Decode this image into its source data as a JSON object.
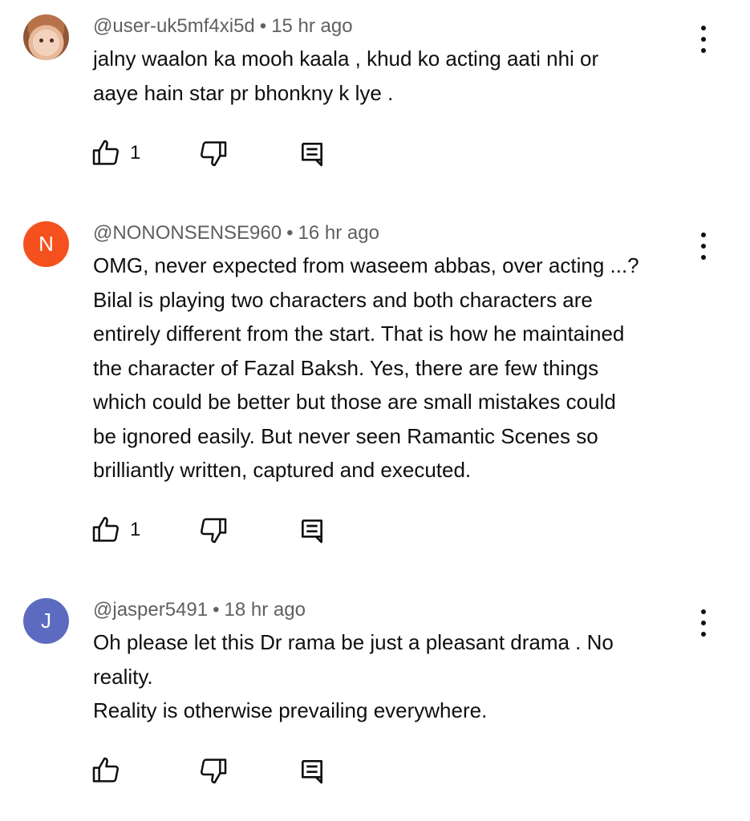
{
  "comments": [
    {
      "author": "@user-uk5mf4xi5d",
      "separator": "•",
      "time": "15 hr ago",
      "avatar_letter": "",
      "avatar_color": "#b7724a",
      "lines": [
        "jalny waalon ka mooh kaala , khud ko acting aati nhi or",
        "aaye hain star pr bhonkny k lye ."
      ],
      "like_count": "1",
      "icons": {
        "like": "thumbs-up-icon",
        "dislike": "thumbs-down-icon",
        "reply": "reply-comment-icon",
        "more": "more-vertical-icon"
      }
    },
    {
      "author": "@NONONSENSE960",
      "separator": "•",
      "time": "16 hr ago",
      "avatar_letter": "N",
      "avatar_color": "#f4511e",
      "lines": [
        "OMG, never expected from waseem abbas, over acting ...?",
        "Bilal is playing two characters and both characters are",
        "entirely different from the start. That is how he maintained",
        "the character of Fazal Baksh. Yes, there are few things",
        "which could be better but those are small mistakes could",
        "be ignored easily. But never seen Ramantic Scenes so",
        "brilliantly written, captured and executed."
      ],
      "like_count": "1",
      "icons": {
        "like": "thumbs-up-icon",
        "dislike": "thumbs-down-icon",
        "reply": "reply-comment-icon",
        "more": "more-vertical-icon"
      }
    },
    {
      "author": "@jasper5491",
      "separator": "•",
      "time": "18 hr ago",
      "avatar_letter": "J",
      "avatar_color": "#5c6bc0",
      "lines": [
        "Oh please let this Dr rama be just a pleasant drama . No",
        "reality.",
        "Reality is otherwise prevailing everywhere."
      ],
      "like_count": "",
      "icons": {
        "like": "thumbs-up-icon",
        "dislike": "thumbs-down-icon",
        "reply": "reply-comment-icon",
        "more": "more-vertical-icon"
      }
    }
  ]
}
